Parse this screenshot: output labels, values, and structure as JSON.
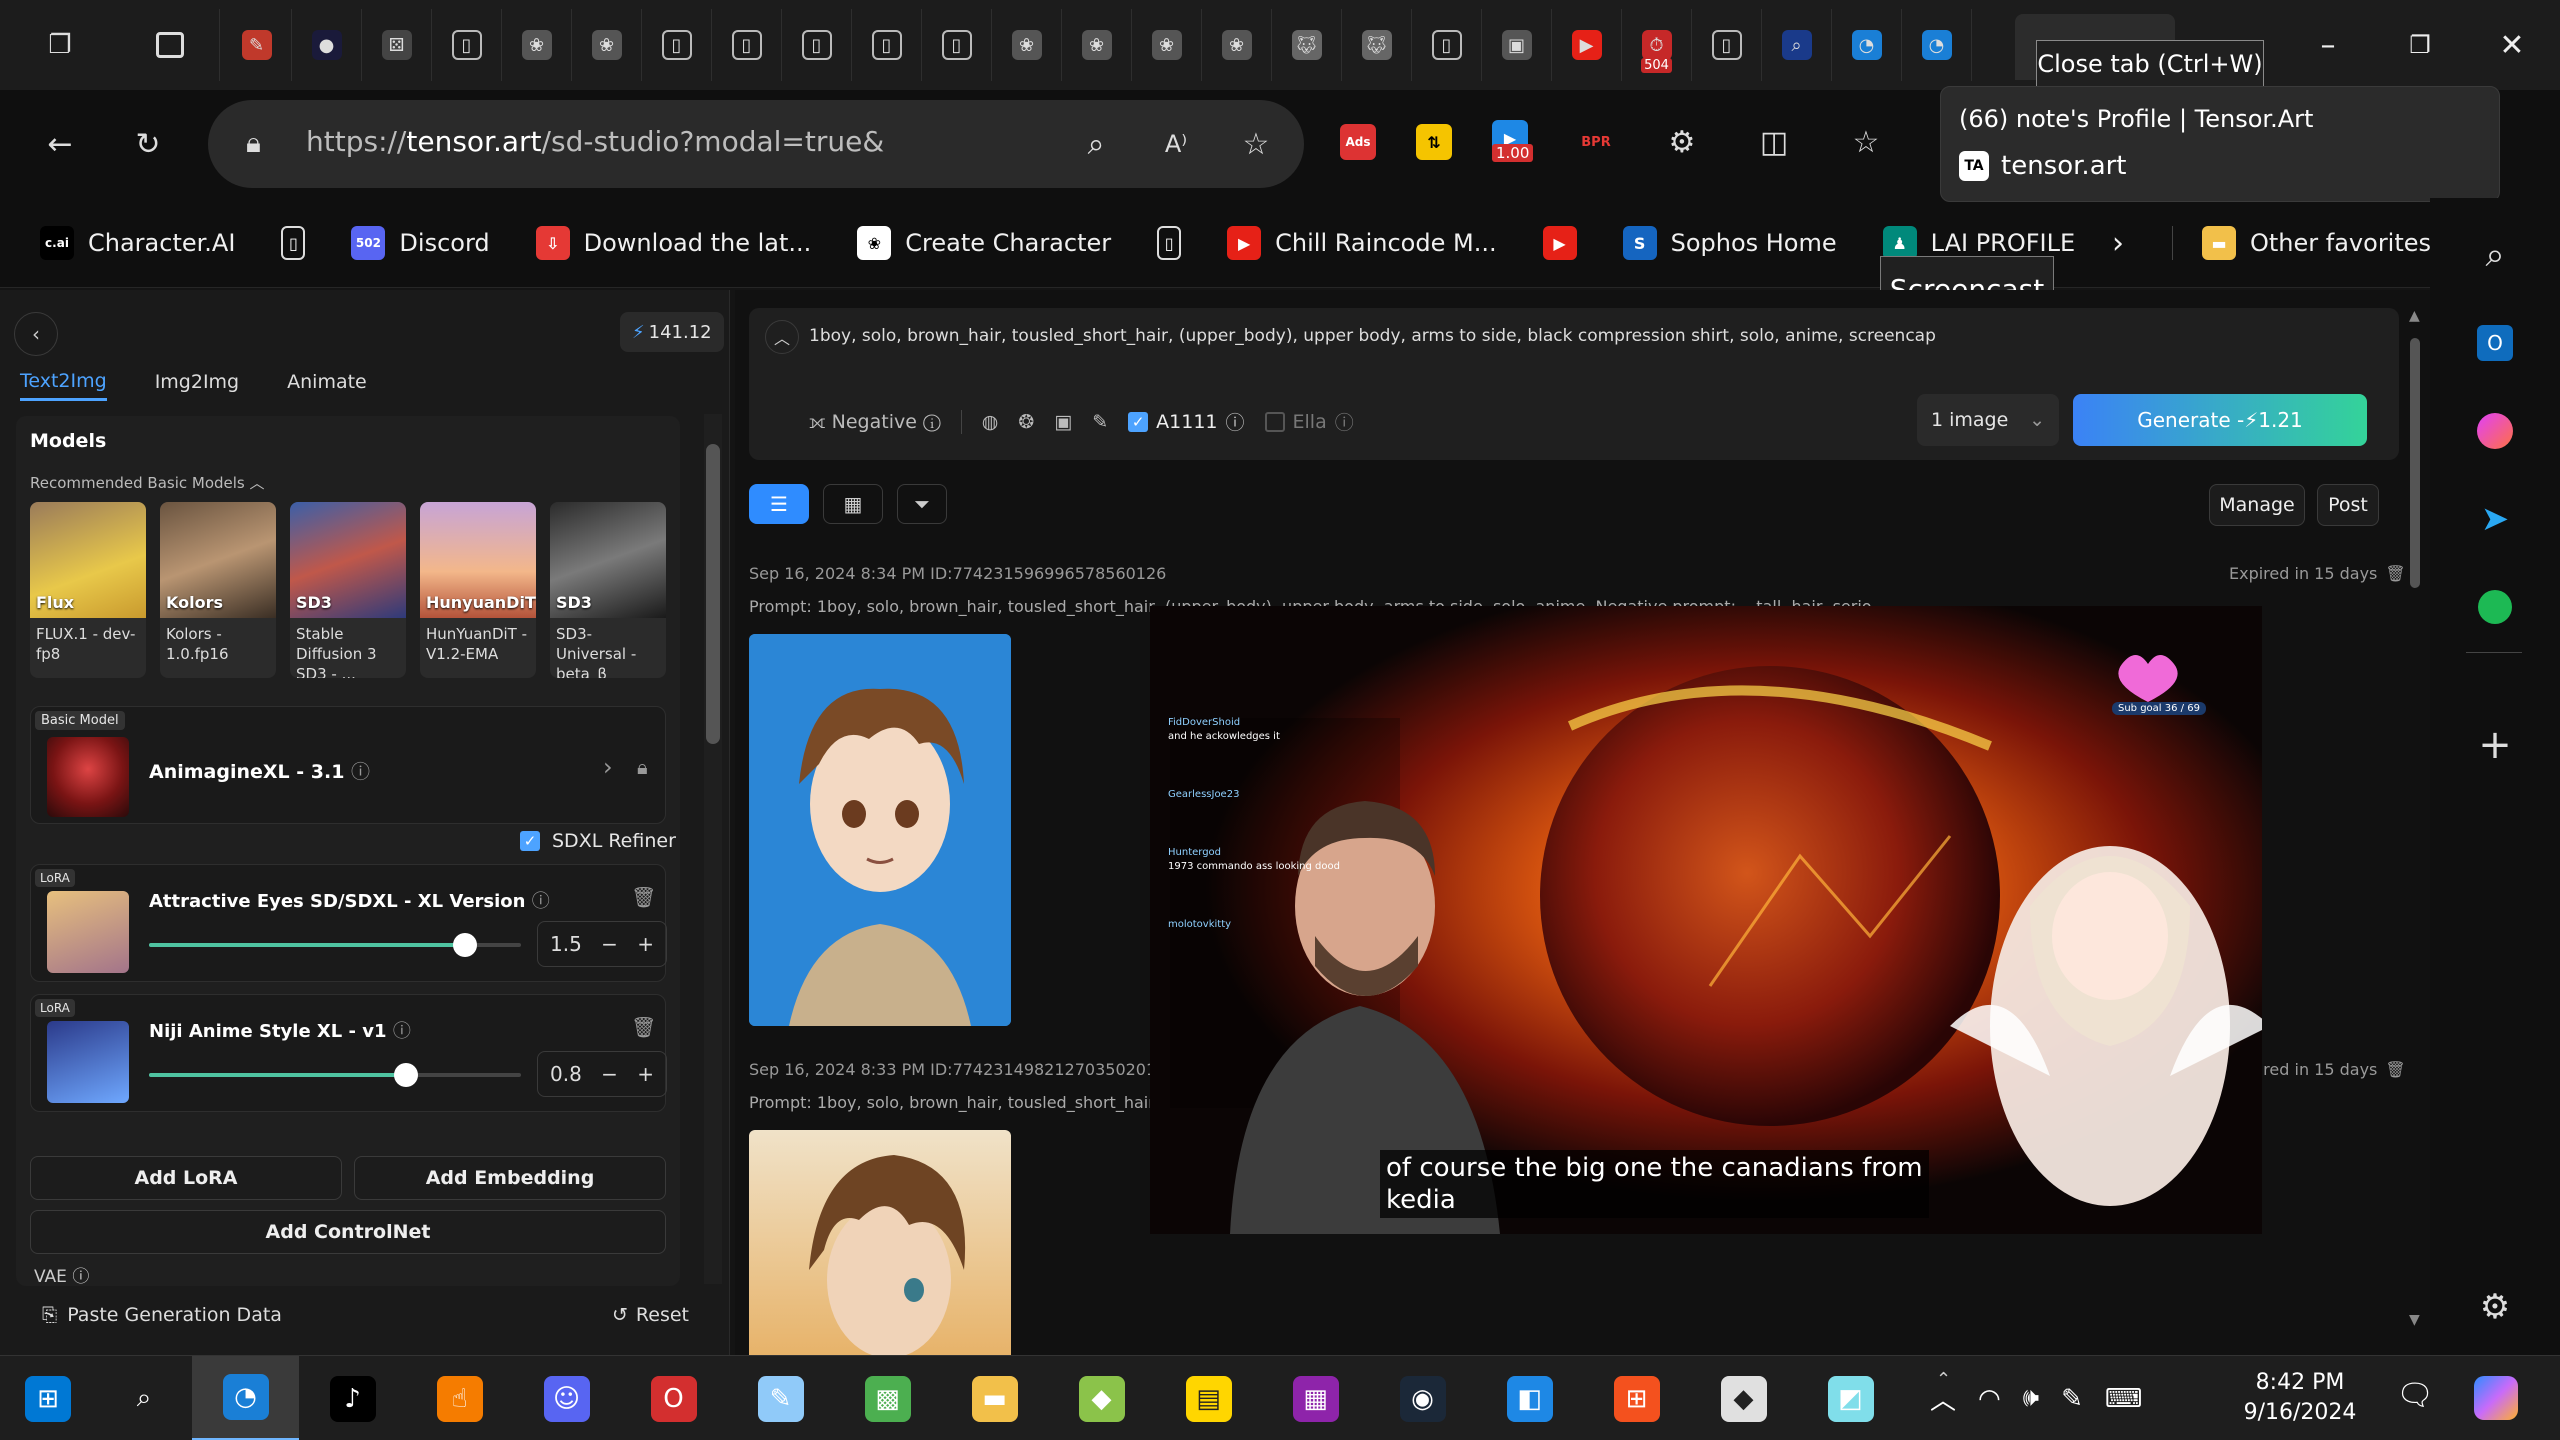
{
  "browser": {
    "tabs": {
      "close_tooltip": "Close tab (Ctrl+W)",
      "preview_title": "(66) note's Profile | Tensor.Art",
      "preview_domain": "tensor.art",
      "screencast_tooltip": "Screencast",
      "icons": [
        "note-icon",
        "circle-icon",
        "dice-icon",
        "doc-icon",
        "openai-icon",
        "openai-icon",
        "doc-icon",
        "doc-icon",
        "doc-icon",
        "doc-icon",
        "doc-icon",
        "openai-icon",
        "openai-icon",
        "openai-icon",
        "openai-icon",
        "wolf-icon",
        "wolf-icon",
        "doc-icon",
        "screen-icon",
        "youtube-icon",
        "stopwatch-icon",
        "doc-icon",
        "search-icon",
        "edge-icon",
        "edge-icon"
      ],
      "badge_504": "504",
      "active_tab_icon": "tensor-icon"
    },
    "address": {
      "url_prefix": "https://",
      "url_host": "tensor.art",
      "url_path": "/sd-studio?modal=true&"
    },
    "toolbar_badge": "1.00",
    "favorites": [
      {
        "label": "Character.AI",
        "icon": "c.ai"
      },
      {
        "label": "",
        "icon": "doc-icon"
      },
      {
        "label": "Discord",
        "icon": "502"
      },
      {
        "label": "Download the lat...",
        "icon": "download-icon"
      },
      {
        "label": "Create Character",
        "icon": "openai-icon"
      },
      {
        "label": "",
        "icon": "doc-icon"
      },
      {
        "label": "Chill Raincode M...",
        "icon": "youtube-icon"
      },
      {
        "label": "",
        "icon": "youtube-icon"
      },
      {
        "label": "Sophos Home",
        "icon": "S"
      },
      {
        "label": "LAI PROFILE",
        "icon": "figure-icon"
      }
    ],
    "other_favorites": "Other favorites"
  },
  "panel": {
    "credits": "141.12",
    "tabs": [
      "Text2Img",
      "Img2Img",
      "Animate"
    ],
    "models_title": "Models",
    "recommended_label": "Recommended Basic Models",
    "models": [
      {
        "tag": "Flux",
        "caption": "FLUX.1 - dev-fp8"
      },
      {
        "tag": "Kolors",
        "caption": "Kolors - 1.0.fp16"
      },
      {
        "tag": "SD3",
        "caption": "Stable Diffusion 3 SD3 - ..."
      },
      {
        "tag": "HunyuanDiT",
        "caption": "HunYuanDiT - V1.2-EMA"
      },
      {
        "tag": "SD3",
        "caption": "SD3-Universal - beta_β"
      }
    ],
    "basic_model_badge": "Basic Model",
    "basic_model_name": "AnimagineXL - 3.1",
    "sdxl_refiner": "SDXL Refiner",
    "loras": [
      {
        "badge": "LoRA",
        "name": "Attractive Eyes SD/SDXL - XL Version",
        "value": "1.5",
        "fill": 0.85
      },
      {
        "badge": "LoRA",
        "name": "Niji Anime Style XL - v1",
        "value": "0.8",
        "fill": 0.69
      }
    ],
    "add_lora": "Add LoRA",
    "add_embedding": "Add Embedding",
    "add_controlnet": "Add ControlNet",
    "vae": "VAE",
    "paste": "Paste Generation Data",
    "reset": "Reset"
  },
  "main": {
    "prompt": "1boy, solo, brown_hair, tousled_short_hair, (upper_body), upper body, arms to side, black compression shirt, solo, anime, screencap",
    "negative": "Negative",
    "a1111": "A1111",
    "ella": "Ella",
    "image_count": "1 image",
    "generate_label": "Generate - ",
    "generate_cost": "1.21",
    "manage": "Manage",
    "post": "Post",
    "entries": [
      {
        "meta": "Sep 16, 2024 8:34 PM ID:774231596996578560126",
        "expires": "Expired in 15 days",
        "prompt": "Prompt: 1boy, solo, brown_hair, tousled_short_hair, (upper_body), upper body, arms to side, solo, anime, Negative prompt: ...tall, hair, serio..."
      },
      {
        "meta": "Sep 16, 2024 8:33 PM ID:774231498212703502012​6",
        "expires": "Expired in 15 days",
        "prompt": "Prompt: 1boy, solo, brown_hair, tousled_short_hair, (upper... rt hair, serio..."
      }
    ]
  },
  "overlay": {
    "caption_line1": "of course the big one the canadians from",
    "caption_line2": "kedia",
    "chat": [
      {
        "user": "FidDoverShoid",
        "msg": "and he ackowledges it"
      },
      {
        "user": "GearlessJoe23",
        "msg": ""
      },
      {
        "user": "Huntergod",
        "msg": "1973 commando ass looking dood"
      },
      {
        "user": "molotovkitty",
        "msg": ""
      }
    ],
    "sub_goal": "Sub goal",
    "sub_goal_count": "36 / 69"
  },
  "taskbar": {
    "time": "8:42 PM",
    "date": "9/16/2024"
  },
  "colors": {
    "accent": "#2f8cff",
    "generate_start": "#3b82f6",
    "generate_end": "#34d399",
    "slider": "#4fc3a1"
  }
}
